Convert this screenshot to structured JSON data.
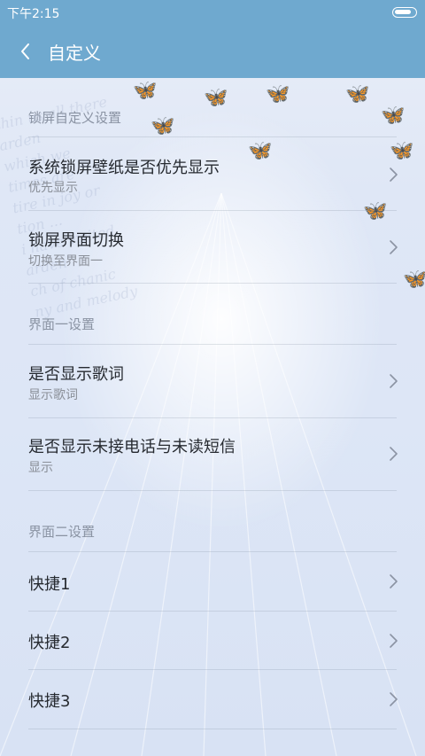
{
  "status_bar": {
    "time": "下午2:15",
    "battery_level": 0.85
  },
  "title_bar": {
    "title": "自定义",
    "back_icon": "chevron-left-icon"
  },
  "sections": [
    {
      "header": "锁屏自定义设置",
      "items": [
        {
          "title": "系统锁屏壁纸是否优先显示",
          "subtitle": "优先显示"
        },
        {
          "title": "锁屏界面切换",
          "subtitle": "切换至界面一"
        }
      ]
    },
    {
      "header": "界面一设置",
      "items": [
        {
          "title": "是否显示歌词",
          "subtitle": "显示歌词"
        },
        {
          "title": "是否显示未接电话与未读短信",
          "subtitle": "显示"
        }
      ]
    },
    {
      "header": "界面二设置",
      "items": [
        {
          "title": "快捷1"
        },
        {
          "title": "快捷2"
        },
        {
          "title": "快捷3"
        }
      ]
    }
  ],
  "background_text": [
    "thin us all there",
    "arden",
    "which we",
    "times are",
    "tire in joy or",
    "tion ...",
    "i have visited",
    "arden",
    "ch of chanic",
    "ny and melody"
  ],
  "colors": {
    "header": "#6fa9cf",
    "section_text": "#8a93a3",
    "primary_text": "#262a30"
  }
}
